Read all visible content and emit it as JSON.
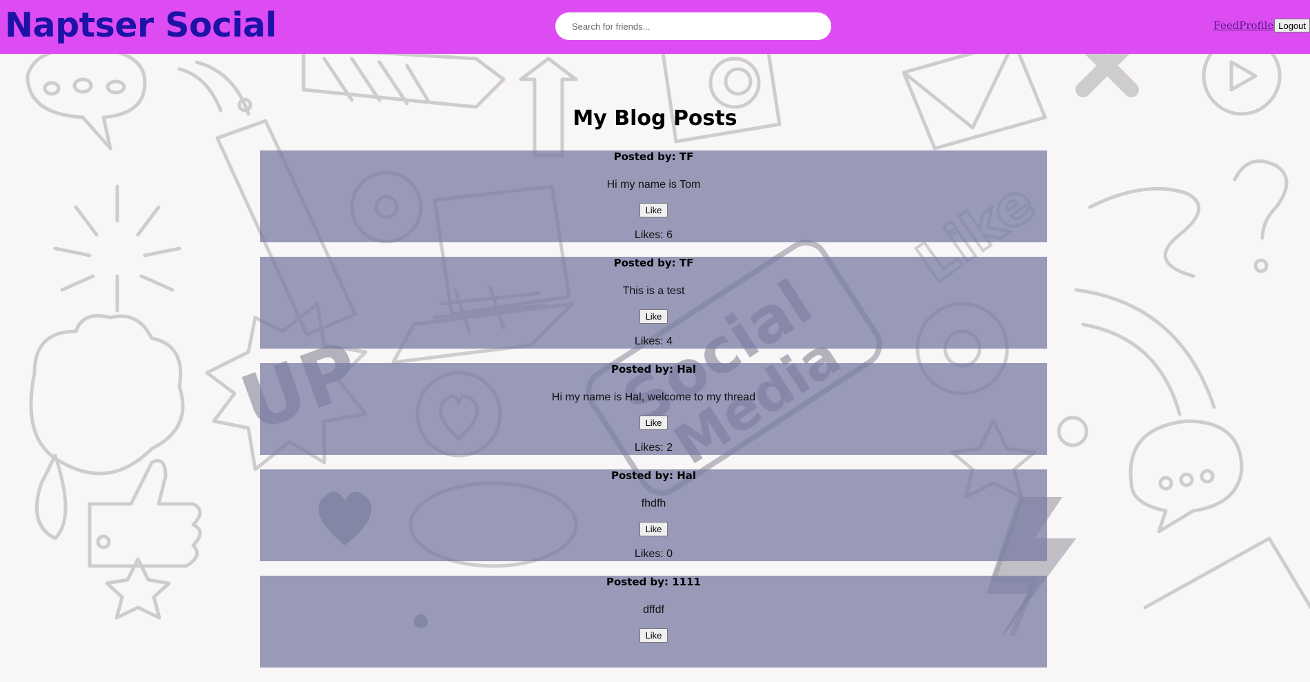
{
  "header": {
    "brand": "Naptser Social",
    "search_placeholder": "Search for friends...",
    "links": [
      "Feed",
      "Profile"
    ],
    "logout_label": "Logout"
  },
  "main": {
    "title": "My Blog Posts",
    "posts": [
      {
        "author": "Posted by: TF",
        "body": "Hi my name is Tom",
        "like_label": "Like",
        "likes": "Likes: 6"
      },
      {
        "author": "Posted by: TF",
        "body": "This is a test",
        "like_label": "Like",
        "likes": "Likes: 4"
      },
      {
        "author": "Posted by: Hal",
        "body": "Hi my name is Hal, welcome to my thread",
        "like_label": "Like",
        "likes": "Likes: 2"
      },
      {
        "author": "Posted by: Hal",
        "body": "fhdfh",
        "like_label": "Like",
        "likes": "Likes: 0"
      },
      {
        "author": "Posted by: 1111",
        "body": "dffdf",
        "like_label": "Like",
        "likes": ""
      }
    ]
  },
  "colors": {
    "header_bg": "#dc4cf2",
    "brand": "#1d12a6",
    "post_bg": "#787ba3"
  }
}
